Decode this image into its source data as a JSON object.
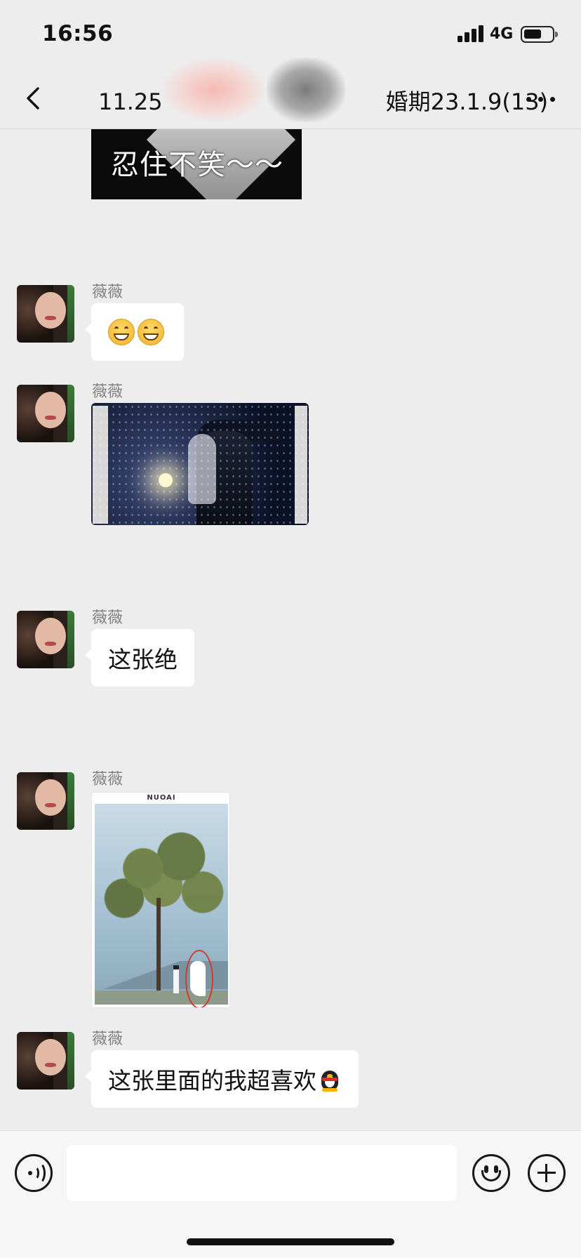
{
  "status_bar": {
    "time": "16:56",
    "network": "4G"
  },
  "nav": {
    "title_prefix": "11.25",
    "title_suffix": "婚期23.1.9(13)"
  },
  "messages": [
    {
      "type": "image",
      "caption": "忍住不笑～～"
    },
    {
      "type": "emoji",
      "sender": "薇薇"
    },
    {
      "type": "image",
      "sender": "薇薇"
    },
    {
      "type": "text",
      "sender": "薇薇",
      "text": "这张绝"
    },
    {
      "type": "image",
      "sender": "薇薇",
      "brand": "NUOAI"
    },
    {
      "type": "text",
      "sender": "薇薇",
      "text": "这张里面的我超喜欢"
    }
  ],
  "input": {
    "value": "",
    "placeholder": ""
  },
  "icons": {
    "back": "chevron-left-icon",
    "more": "more-dots-icon",
    "voice": "voice-icon",
    "emoji": "smiley-icon",
    "plus": "plus-icon"
  }
}
